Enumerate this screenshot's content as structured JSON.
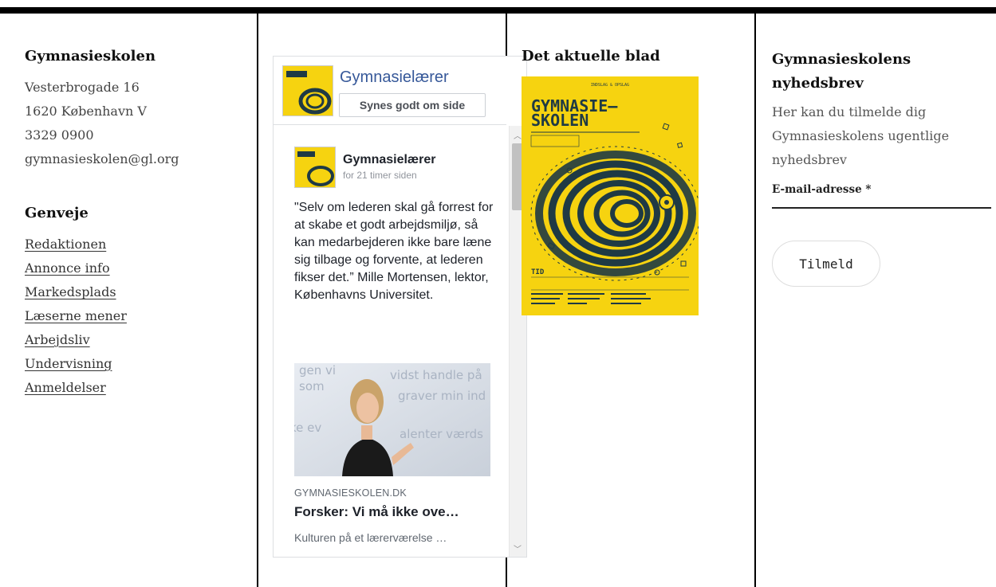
{
  "colors": {
    "accent_yellow": "#f6d310",
    "cover_ink": "#1f3a44",
    "fb_link": "#365899"
  },
  "contact": {
    "heading": "Gymnasieskolen",
    "address_line1": "Vesterbrogade 16",
    "address_line2": "1620 København V",
    "phone": "3329 0900",
    "email": "gymnasieskolen@gl.org"
  },
  "shortcuts": {
    "heading": "Genveje",
    "links": [
      "Redaktionen",
      "Annonce info",
      "Markedsplads",
      "Læserne mener",
      "Arbejdsliv",
      "Undervisning",
      "Anmeldelser"
    ]
  },
  "facebook": {
    "page_name": "Gymnasielærer",
    "like_button": "Synes godt om side",
    "post": {
      "author": "Gymnasielærer",
      "time": "for 21 timer siden",
      "text": "\"Selv om lederen skal gå forrest for at skabe et godt arbejdsmiljø, så kan medarbejderen ikke bare læne sig tilbage og forvente, at lederen fikser det.” Mille Mortensen, lektor, Københavns Universitet.",
      "image_bg_text": "...vidst handle på ... som ... graver min ind... ke ev... alenter værds...",
      "link_domain": "GYMNASIESKOLEN.DK",
      "link_title": "Forsker: Vi må ikke ove…",
      "link_desc": "Kulturen på et lærerværelse …"
    }
  },
  "magazine": {
    "heading": "Det aktuelle blad",
    "cover_title_line1": "GYMNASIE—",
    "cover_title_line2": "SKOLEN",
    "cover_topline": "INDSLAG & OPSLAG",
    "cover_theme": "TID"
  },
  "newsletter": {
    "heading": "Gymnasieskolens nyhedsbrev",
    "text": "Her kan du tilmelde dig Gymnasieskolens ugentlige nyhedsbrev",
    "email_label": "E-mail-adresse *",
    "email_value": "",
    "submit": "Tilmeld"
  }
}
